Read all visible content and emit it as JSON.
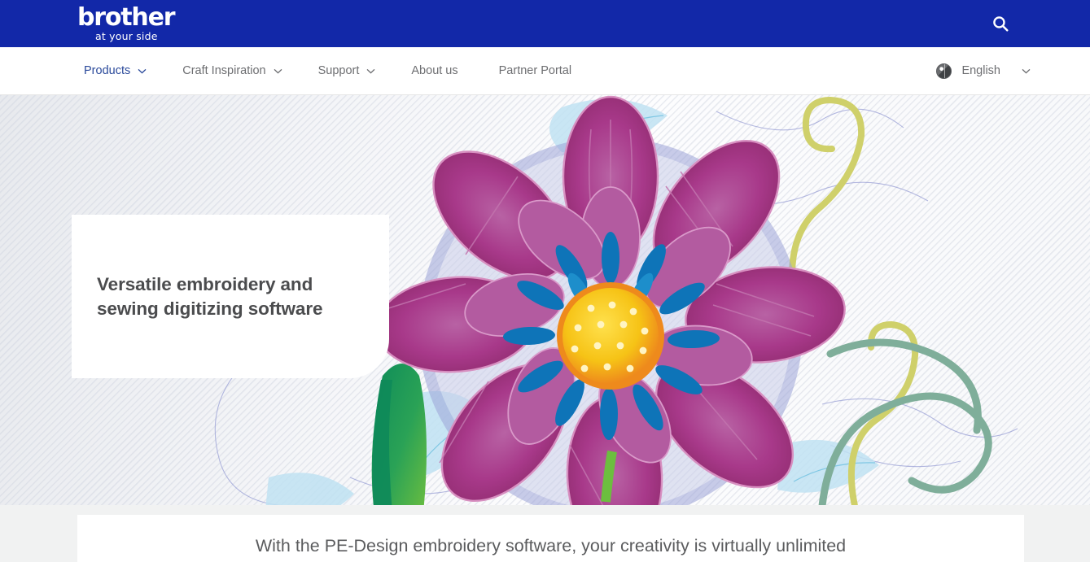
{
  "header": {
    "logo_word": "brother",
    "logo_tagline": "at your side",
    "search_icon": "search-icon",
    "background_color": "#1228a8"
  },
  "nav": {
    "items": [
      {
        "label": "Products",
        "has_dropdown": true,
        "active": true
      },
      {
        "label": "Craft Inspiration",
        "has_dropdown": true,
        "active": false
      },
      {
        "label": "Support",
        "has_dropdown": true,
        "active": false
      },
      {
        "label": "About us",
        "has_dropdown": false,
        "active": false
      },
      {
        "label": "Partner Portal",
        "has_dropdown": false,
        "active": false
      }
    ],
    "language": {
      "icon": "globe-icon",
      "label": "English",
      "caret": "chevron-down-icon"
    }
  },
  "hero": {
    "title_line1": "Versatile embroidery and",
    "title_line2": "sewing digitizing software",
    "image_alt": "embroidered magenta flower with blue inner petals and yellow center on white fabric",
    "colors": {
      "petal_dark": "#8f2a6e",
      "petal_mid": "#a83b86",
      "petal_light": "#b862a4",
      "center_yellow": "#f5c518",
      "center_orange": "#ef8a1e",
      "inner_blue": "#0e74b8",
      "leaf_dark_green": "#0e8a5a",
      "leaf_light_green": "#6cbe3f",
      "swirl_sage": "#7fae9a",
      "swirl_olive": "#cfd06a",
      "outline_violet": "#9aa0d6",
      "pale_blue": "#a9d8ec"
    }
  },
  "lower": {
    "headline": "With the PE-Design embroidery software, your creativity is virtually unlimited"
  }
}
